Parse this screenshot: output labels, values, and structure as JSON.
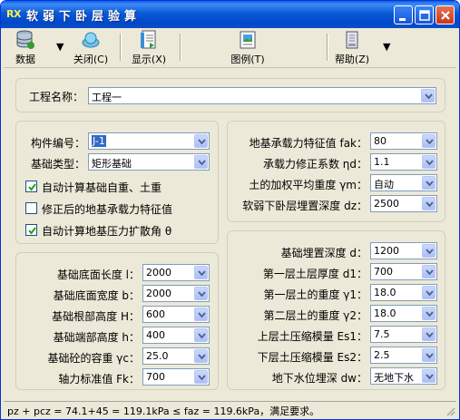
{
  "window": {
    "app_icon_text": "RX",
    "title": "软弱下卧层验算"
  },
  "toolbar": {
    "data": "数据",
    "close": "关闭(C)",
    "show": "显示(X)",
    "legend": "图例(T)",
    "help": "帮助(Z)"
  },
  "project": {
    "label": "工程名称：",
    "value": "工程一"
  },
  "member": {
    "id_label": "构件编号：",
    "id_value": "J-1",
    "type_label": "基础类型：",
    "type_value": "矩形基础",
    "chk_self_weight": "自动计算基础自重、土重",
    "chk_self_weight_checked": true,
    "chk_corrected": "修正后的地基承载力特征值",
    "chk_corrected_checked": false,
    "chk_spread_angle": "自动计算地基压力扩散角  θ",
    "chk_spread_angle_checked": true
  },
  "foundation": {
    "length_label": "基础底面长度 l：",
    "length_value": "2000",
    "width_label": "基础底面宽度 b：",
    "width_value": "2000",
    "root_h_label": "基础根部高度 H：",
    "root_h_value": "600",
    "end_h_label": "基础端部高度 h：",
    "end_h_value": "400",
    "unit_weight_label": "基础砼的容重 γc：",
    "unit_weight_value": "25.0",
    "axial_label": "轴力标准值 Fk：",
    "axial_value": "700"
  },
  "bearing": {
    "fak_label": "地基承载力特征值 fak：",
    "fak_value": "80",
    "eta_label": "承载力修正系数 ηd：",
    "eta_value": "1.1",
    "gamma_m_label": "土的加权平均重度 γm：",
    "gamma_m_value": "自动",
    "dz_label": "软弱下卧层埋置深度 dz：",
    "dz_value": "2500"
  },
  "soil": {
    "d_label": "基础埋置深度 d：",
    "d_value": "1200",
    "d1_label": "第一层土层厚度 d1：",
    "d1_value": "700",
    "g1_label": "第一层土的重度 γ1：",
    "g1_value": "18.0",
    "g2_label": "第二层土的重度 γ2：",
    "g2_value": "18.0",
    "es1_label": "上层土压缩模量 Es1：",
    "es1_value": "7.5",
    "es2_label": "下层土压缩模量 Es2：",
    "es2_value": "2.5",
    "dw_label": "地下水位埋深 dw：",
    "dw_value": "无地下水"
  },
  "status": {
    "text": "pz + pcz = 74.1+45 = 119.1kPa ≤ faz = 119.6kPa，满足要求。"
  },
  "colors": {
    "titlebar": "#0a5ad6",
    "window_bg": "#ece9d8",
    "selection": "#316ac5"
  }
}
